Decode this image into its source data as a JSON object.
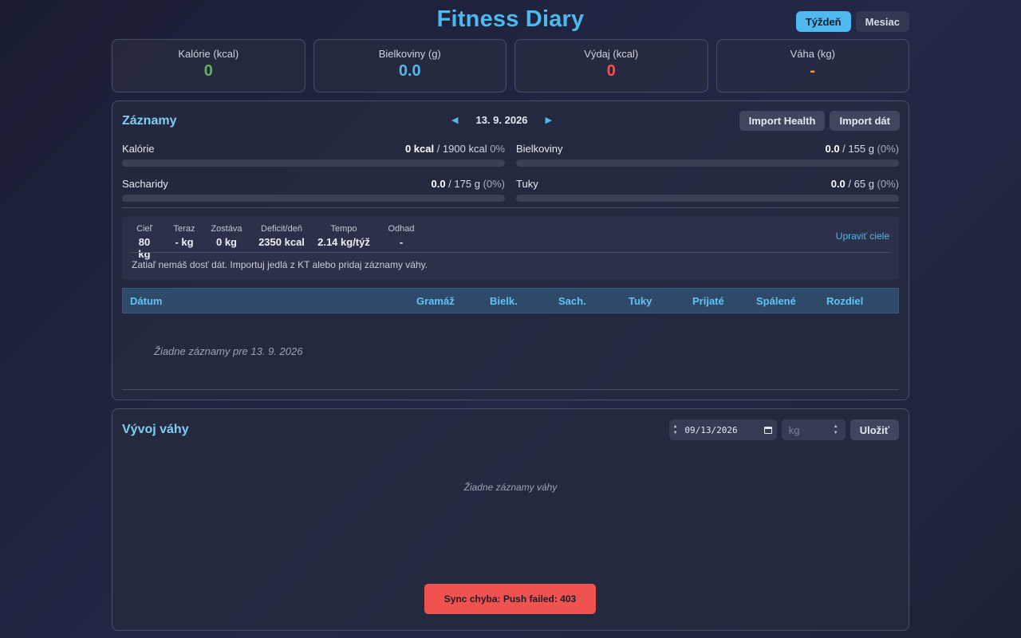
{
  "app": {
    "title": "Fitness Diary"
  },
  "period": {
    "week": "Týždeň",
    "month": "Mesiac",
    "selected": "week"
  },
  "stats": [
    {
      "label": "Kalórie (kcal)",
      "value": "0",
      "color": "#5cb85c"
    },
    {
      "label": "Bielkoviny (g)",
      "value": "0.0",
      "color": "#4fb8ee"
    },
    {
      "label": "Výdaj (kcal)",
      "value": "0",
      "color": "#ef5350"
    },
    {
      "label": "Váha (kg)",
      "value": "-",
      "color": "#f0a030"
    }
  ],
  "records": {
    "title": "Záznamy",
    "date": "13. 9. 2026",
    "import_health": "Import Health",
    "import_data": "Import dát",
    "macros": {
      "calories": {
        "name": "Kalórie",
        "current": "0 kcal",
        "goal": " / 1900 kcal",
        "pct": " 0%",
        "fill": 0
      },
      "protein": {
        "name": "Bielkoviny",
        "current": "0.0",
        "goal": " / 155 g",
        "pct": " (0%)",
        "fill": 0
      },
      "carbs": {
        "name": "Sacharidy",
        "current": "0.0",
        "goal": " / 175 g",
        "pct": " (0%)",
        "fill": 0
      },
      "fat": {
        "name": "Tuky",
        "current": "0.0",
        "goal": " / 65 g",
        "pct": " (0%)",
        "fill": 0
      }
    },
    "goals": {
      "target": {
        "label": "Cieľ",
        "value": "80 kg"
      },
      "current": {
        "label": "Teraz",
        "value": "- kg"
      },
      "remaining": {
        "label": "Zostáva",
        "value": "0 kg"
      },
      "deficit": {
        "label": "Deficit/deň",
        "value": "2350 kcal"
      },
      "pace": {
        "label": "Tempo",
        "value": "2.14 kg/týž"
      },
      "estimate": {
        "label": "Odhad",
        "value": "-"
      },
      "edit": "Upraviť ciele",
      "note": "Zatiaľ nemáš dosť dát. Importuj jedlá z KT alebo pridaj záznamy váhy."
    },
    "table": {
      "headers": {
        "date": "Dátum",
        "grams": "Gramáž",
        "protein": "Bielk.",
        "carbs": "Sach.",
        "fat": "Tuky",
        "intake": "Prijaté",
        "burned": "Spálené",
        "diff": "Rozdiel"
      },
      "empty": "Žiadne záznamy pre 13. 9. 2026"
    }
  },
  "weight": {
    "title": "Vývoj váhy",
    "date_value": "09/13/2026",
    "kg_placeholder": "kg",
    "save": "Uložiť",
    "empty": "Žiadne záznamy váhy"
  },
  "toast": {
    "message": "Sync chyba: Push failed: 403"
  }
}
